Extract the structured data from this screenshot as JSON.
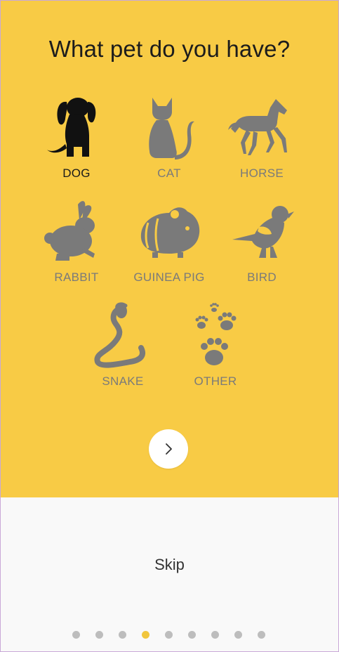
{
  "title": "What pet do you have?",
  "pets": [
    {
      "label": "DOG",
      "icon": "dog-icon",
      "selected": true
    },
    {
      "label": "CAT",
      "icon": "cat-icon",
      "selected": false
    },
    {
      "label": "HORSE",
      "icon": "horse-icon",
      "selected": false
    },
    {
      "label": "RABBIT",
      "icon": "rabbit-icon",
      "selected": false
    },
    {
      "label": "GUINEA PIG",
      "icon": "guinea-pig-icon",
      "selected": false
    },
    {
      "label": "BIRD",
      "icon": "bird-icon",
      "selected": false
    },
    {
      "label": "SNAKE",
      "icon": "snake-icon",
      "selected": false
    },
    {
      "label": "OTHER",
      "icon": "paw-prints-icon",
      "selected": false
    }
  ],
  "next_icon": "chevron-right-icon",
  "skip_label": "Skip",
  "pagination": {
    "total": 9,
    "active_index": 3
  },
  "colors": {
    "background_yellow": "#f8cb45",
    "icon_gray": "#7a7a7a",
    "selected": "#111111",
    "active_dot": "#f1c63d",
    "inactive_dot": "#bdbdbd"
  }
}
